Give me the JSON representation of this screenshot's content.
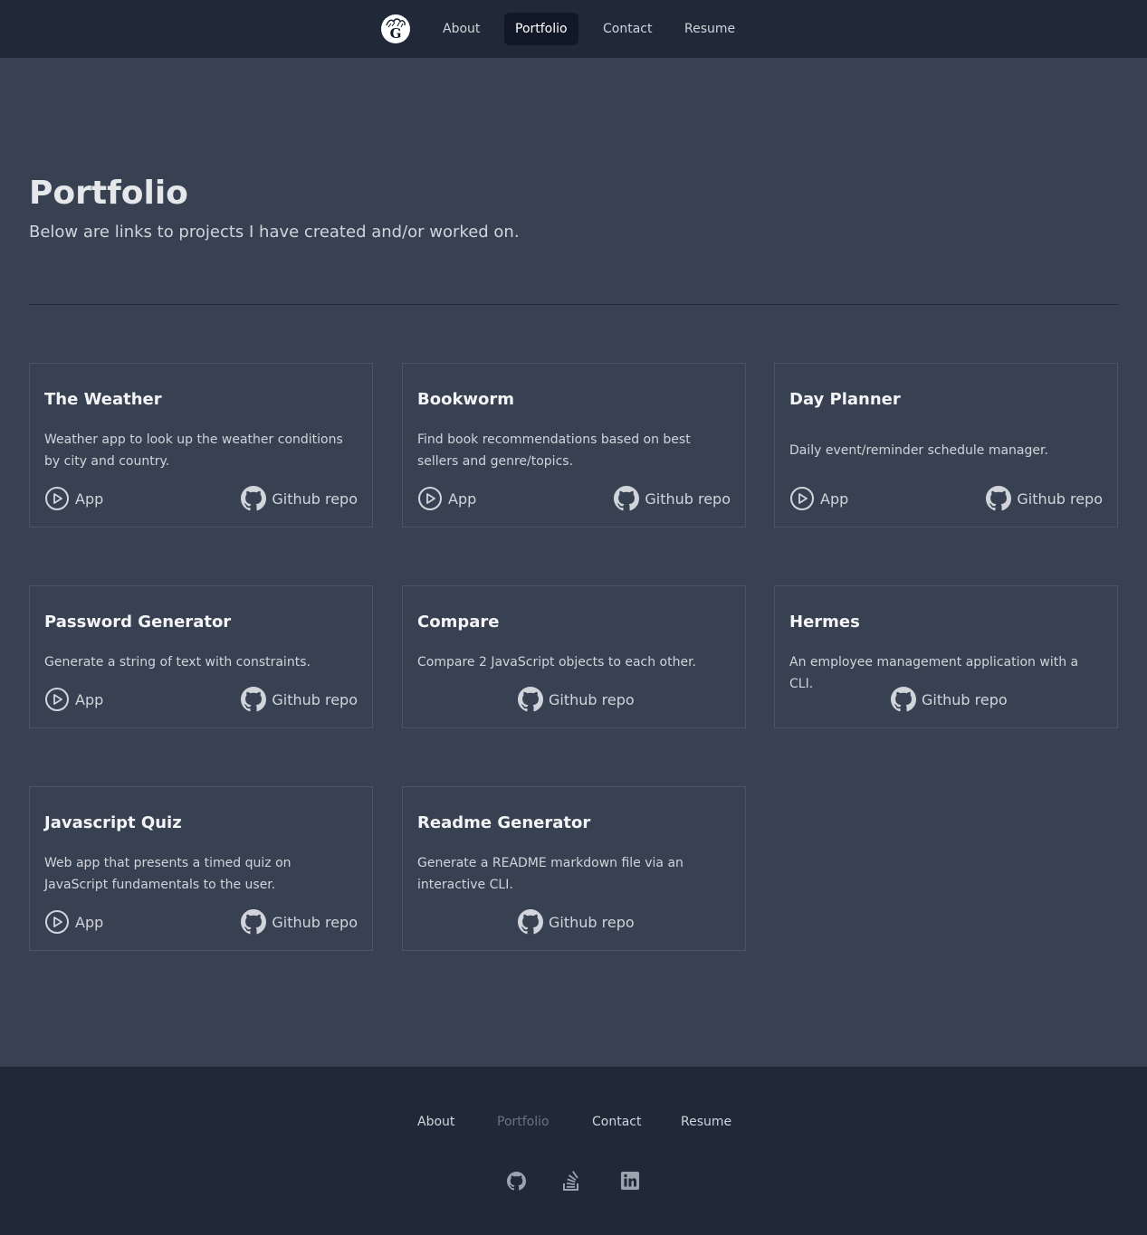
{
  "nav": {
    "logo_alt": "G",
    "items": [
      {
        "label": "About"
      },
      {
        "label": "Portfolio"
      },
      {
        "label": "Contact"
      },
      {
        "label": "Resume"
      }
    ]
  },
  "header": {
    "title": "Portfolio",
    "subtitle": "Below are links to projects I have created and/or worked on."
  },
  "projects": [
    {
      "title": "The Weather",
      "description": "Weather app to look up the weather conditions by city and country.",
      "app_label": "App",
      "repo_label": "Github repo"
    },
    {
      "title": "Bookworm",
      "description": "Find book recommendations based on best sellers and genre/topics.",
      "app_label": "App",
      "repo_label": "Github repo"
    },
    {
      "title": "Day Planner",
      "description": "Daily event/reminder schedule manager.",
      "app_label": "App",
      "repo_label": "Github repo"
    },
    {
      "title": "Password Generator",
      "description": "Generate a string of text with constraints.",
      "app_label": "App",
      "repo_label": "Github repo"
    },
    {
      "title": "Compare",
      "description": "Compare 2 JavaScript objects to each other.",
      "repo_label": "Github repo"
    },
    {
      "title": "Hermes",
      "description": "An employee management application with a CLI.",
      "repo_label": "Github repo"
    },
    {
      "title": "Javascript Quiz",
      "description": "Web app that presents a timed quiz on JavaScript fundamentals to the user.",
      "app_label": "App",
      "repo_label": "Github repo"
    },
    {
      "title": "Readme Generator",
      "description": "Generate a README markdown file via an interactive CLI.",
      "repo_label": "Github repo"
    }
  ],
  "footer": {
    "links": [
      {
        "label": "About"
      },
      {
        "label": "Portfolio"
      },
      {
        "label": "Contact"
      },
      {
        "label": "Resume"
      }
    ],
    "social_icons": [
      "github-icon",
      "stackoverflow-icon",
      "linkedin-icon"
    ]
  },
  "colors": {
    "page_bg": "#374151",
    "nav_bg": "#1f2937",
    "active_nav_bg": "#111827",
    "card_border": "#4b5563",
    "muted_link": "#6b7280"
  }
}
